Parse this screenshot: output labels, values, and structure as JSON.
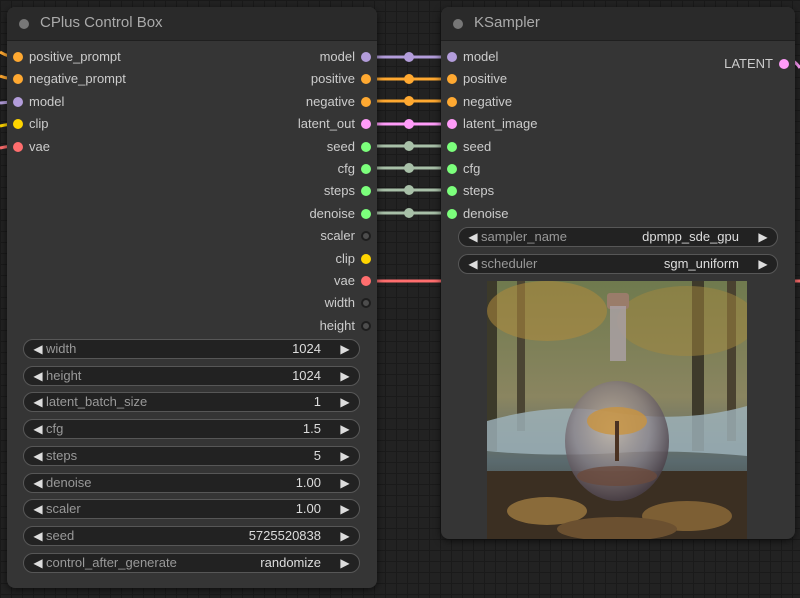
{
  "control_box": {
    "title": "CPlus Control Box",
    "inputs": [
      {
        "label": "positive_prompt",
        "color": "#FFA931"
      },
      {
        "label": "negative_prompt",
        "color": "#FFA931"
      },
      {
        "label": "model",
        "color": "#B39DDB"
      },
      {
        "label": "clip",
        "color": "#FFD500"
      },
      {
        "label": "vae",
        "color": "#FF6E6E"
      }
    ],
    "outputs": [
      {
        "label": "model",
        "color": "#B39DDB"
      },
      {
        "label": "positive",
        "color": "#FFA931"
      },
      {
        "label": "negative",
        "color": "#FFA931"
      },
      {
        "label": "latent_out",
        "color": "#FF9CF9"
      },
      {
        "label": "seed",
        "color": "#7CFF7C"
      },
      {
        "label": "cfg",
        "color": "#7CFF7C"
      },
      {
        "label": "steps",
        "color": "#7CFF7C"
      },
      {
        "label": "denoise",
        "color": "#7CFF7C"
      },
      {
        "label": "scaler",
        "color": "hollow"
      },
      {
        "label": "clip",
        "color": "#FFD500"
      },
      {
        "label": "vae",
        "color": "#FF6E6E"
      },
      {
        "label": "width",
        "color": "hollow"
      },
      {
        "label": "height",
        "color": "hollow"
      }
    ],
    "widgets": [
      {
        "label": "width",
        "value": "1024"
      },
      {
        "label": "height",
        "value": "1024"
      },
      {
        "label": "latent_batch_size",
        "value": "1"
      },
      {
        "label": "cfg",
        "value": "1.5"
      },
      {
        "label": "steps",
        "value": "5"
      },
      {
        "label": "denoise",
        "value": "1.00"
      },
      {
        "label": "scaler",
        "value": "1.00"
      },
      {
        "label": "seed",
        "value": "5725520838"
      },
      {
        "label": "control_after_generate",
        "value": "randomize"
      }
    ]
  },
  "ksampler": {
    "title": "KSampler",
    "output": {
      "label": "LATENT",
      "color": "#FF9CF9"
    },
    "inputs": [
      {
        "label": "model",
        "color": "#B39DDB"
      },
      {
        "label": "positive",
        "color": "#FFA931"
      },
      {
        "label": "negative",
        "color": "#FFA931"
      },
      {
        "label": "latent_image",
        "color": "#FF9CF9"
      },
      {
        "label": "seed",
        "color": "#7CFF7C"
      },
      {
        "label": "cfg",
        "color": "#7CFF7C"
      },
      {
        "label": "steps",
        "color": "#7CFF7C"
      },
      {
        "label": "denoise",
        "color": "#7CFF7C"
      }
    ],
    "widgets": [
      {
        "label": "sampler_name",
        "value": "dpmpp_sde_gpu"
      },
      {
        "label": "scheduler",
        "value": "sgm_uniform"
      }
    ]
  },
  "icons": {
    "decrement": "◀",
    "increment": "▶",
    "collapse": "collapse-dot-icon"
  },
  "colors": {
    "link_model": "#B39DDB",
    "link_conditioning": "#FFA931",
    "link_latent": "#FF9CF9",
    "link_number": "#A8C0A8",
    "link_vae": "#FF6E6E",
    "link_clip": "#FFD500"
  }
}
